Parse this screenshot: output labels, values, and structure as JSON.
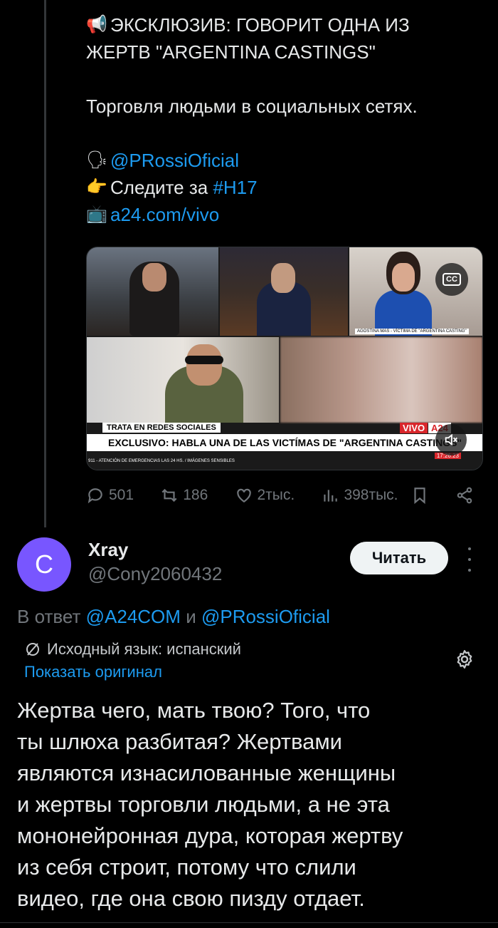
{
  "tweet": {
    "lines": [
      {
        "emoji": "📢",
        "text": "ЭКСКЛЮЗИВ: ГОВОРИТ ОДНА ИЗ"
      },
      {
        "text": "ЖЕРТВ \"ARGENTINA CASTINGS\""
      },
      {
        "text": "Торговля людьми в социальных сетях."
      },
      {
        "emoji": "🗣",
        "text": "@PRossiOficial"
      },
      {
        "emoji": "👉",
        "text_prefix": "Следите за ",
        "text_link": "#H17"
      },
      {
        "emoji": "📺",
        "text": "a24.com/vivo"
      }
    ]
  },
  "media": {
    "lower_third_top": "TRATA EN REDES SOCIALES",
    "lower_third_main": "EXCLUSIVO: HABLA UNA DE LAS VICTÍMAS DE \"ARGENTINA CASTINGS\"",
    "ticker": "911 - ATENCIÓN DE EMERGENCIAS LAS 24 HS. / IMÁGENES SENSIBLES",
    "ticker_time": "17:26:23",
    "guest_caption": "AGOSTINA MAS - VÍCTIMA DE \"ARGENTINA CASTING\"",
    "live_badge": "VIVO",
    "channel": "A24",
    "cc_label": "CC"
  },
  "actions": {
    "replies": "501",
    "retweets": "186",
    "likes": "2тыс.",
    "views": "398тыс."
  },
  "reply": {
    "avatar_letter": "C",
    "avatar_color": "#7856ff",
    "name": "Xray",
    "handle": "@Cony2060432",
    "follow_label": "Читать",
    "reply_prefix": "В ответ",
    "reply_user1": "@A24COM",
    "reply_and": "и",
    "reply_user2": "@PRossiOficial",
    "translated_note": "Исходный язык: испанский",
    "show_original": "Показать оригинал",
    "text_lines": [
      "Жертва чего, мать твою? Того, что",
      "ты шлюха разбитая? Жертвами",
      "являются изнасилованные женщины",
      "и жертвы торговли людьми, а не эта",
      "мононейронная дура, которая жертву",
      "из себя строит, потому что слили",
      "видео, где она свою пизду отдает."
    ]
  },
  "colors": {
    "background": "#000000",
    "link": "#1d9bf0",
    "muted": "#71767b",
    "text": "#e7e9ea"
  }
}
